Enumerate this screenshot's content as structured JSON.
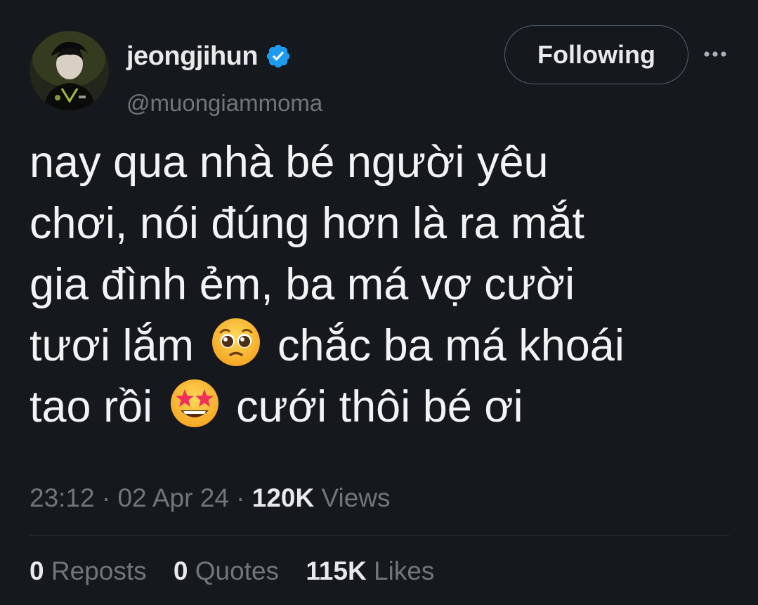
{
  "author": {
    "display_name": "jeongjihun",
    "handle": "@muongiammoma",
    "verified_icon": "verified-badge-icon",
    "avatar_icon": "avatar-photo"
  },
  "actions": {
    "follow_label": "Following",
    "more_icon": "more-horizontal-icon"
  },
  "tweet": {
    "line1": "nay qua nhà bé người yêu",
    "line2": "chơi, nói đúng hơn là ra mắt",
    "line3": "gia đình ẻm, ba má vợ cười",
    "line4a": "tươi lắm",
    "line4b": "chắc ba má khoái",
    "line5a": "tao rồi",
    "line5b": "cưới thôi bé ơi",
    "emoji1": "pleading-face-emoji",
    "emoji2": "star-struck-emoji"
  },
  "meta": {
    "time": "23:12",
    "sep1": "·",
    "date": "02 Apr 24",
    "sep2": "·",
    "views_count": "120K",
    "views_label": "Views"
  },
  "stats": {
    "reposts_count": "0",
    "reposts_label": "Reposts",
    "quotes_count": "0",
    "quotes_label": "Quotes",
    "likes_count": "115K",
    "likes_label": "Likes"
  },
  "colors": {
    "background": "#15181c",
    "text_primary": "#e7e9ea",
    "text_secondary": "#71767b",
    "verified_blue": "#1d9bf0",
    "divider": "#2f3336"
  }
}
